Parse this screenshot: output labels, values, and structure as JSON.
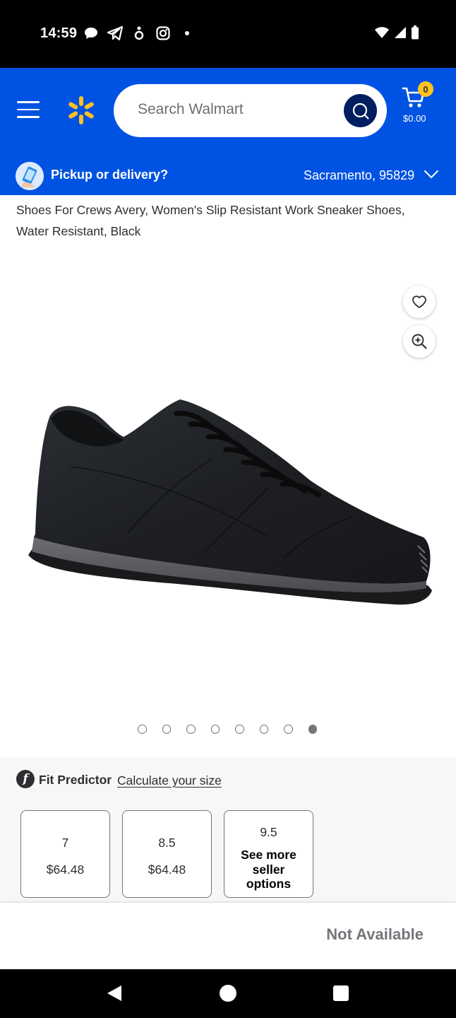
{
  "status_bar": {
    "time": "14:59",
    "left_icons": [
      "chat-bubble-icon",
      "telegram-icon",
      "notification-app-icon",
      "instagram-icon",
      "dot-icon"
    ],
    "right_icons": [
      "wifi-icon",
      "cellular-signal-icon",
      "battery-icon"
    ]
  },
  "header": {
    "search_placeholder": "Search Walmart",
    "cart_count": "0",
    "cart_total": "$0.00",
    "brand_color": "#0053e2",
    "spark_color": "#ffc220"
  },
  "pickup_bar": {
    "label": "Pickup or delivery?",
    "location": "Sacramento, 95829"
  },
  "product": {
    "title": "Shoes For Crews Avery, Women's Slip Resistant Work Sneaker Shoes, Water Resistant, Black",
    "image_icon": "black-sneaker-image",
    "carousel": {
      "total": 8,
      "active_index": 7
    }
  },
  "fit_predictor": {
    "logo": "f",
    "label": "Fit Predictor",
    "link": "Calculate your size"
  },
  "sizes": [
    {
      "size": "7",
      "price": "$64.48"
    },
    {
      "size": "8.5",
      "price": "$64.48"
    },
    {
      "size": "9.5",
      "more": "See more seller options"
    }
  ],
  "availability": {
    "status": "Not Available"
  }
}
